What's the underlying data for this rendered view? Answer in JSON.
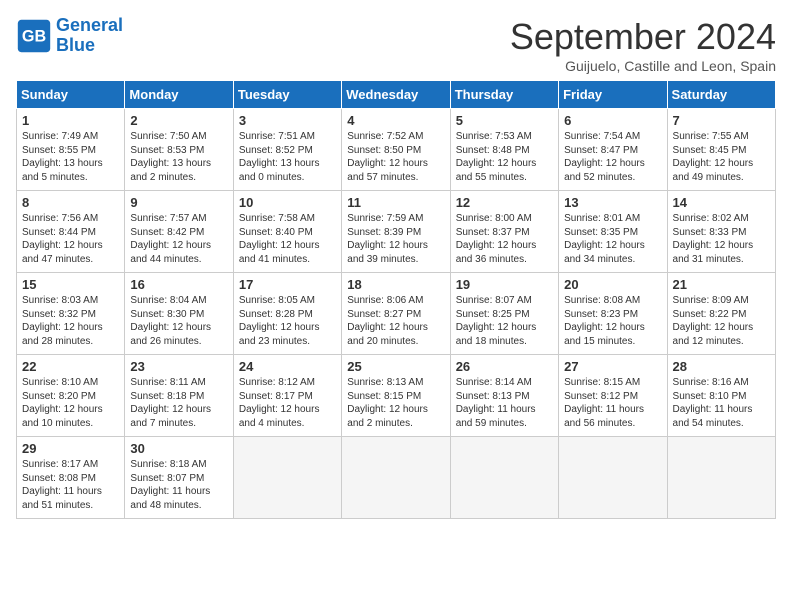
{
  "logo": {
    "line1": "General",
    "line2": "Blue"
  },
  "title": "September 2024",
  "subtitle": "Guijuelo, Castille and Leon, Spain",
  "headers": [
    "Sunday",
    "Monday",
    "Tuesday",
    "Wednesday",
    "Thursday",
    "Friday",
    "Saturday"
  ],
  "weeks": [
    [
      {
        "day": "1",
        "info": "Sunrise: 7:49 AM\nSunset: 8:55 PM\nDaylight: 13 hours\nand 5 minutes."
      },
      {
        "day": "2",
        "info": "Sunrise: 7:50 AM\nSunset: 8:53 PM\nDaylight: 13 hours\nand 2 minutes."
      },
      {
        "day": "3",
        "info": "Sunrise: 7:51 AM\nSunset: 8:52 PM\nDaylight: 13 hours\nand 0 minutes."
      },
      {
        "day": "4",
        "info": "Sunrise: 7:52 AM\nSunset: 8:50 PM\nDaylight: 12 hours\nand 57 minutes."
      },
      {
        "day": "5",
        "info": "Sunrise: 7:53 AM\nSunset: 8:48 PM\nDaylight: 12 hours\nand 55 minutes."
      },
      {
        "day": "6",
        "info": "Sunrise: 7:54 AM\nSunset: 8:47 PM\nDaylight: 12 hours\nand 52 minutes."
      },
      {
        "day": "7",
        "info": "Sunrise: 7:55 AM\nSunset: 8:45 PM\nDaylight: 12 hours\nand 49 minutes."
      }
    ],
    [
      {
        "day": "8",
        "info": "Sunrise: 7:56 AM\nSunset: 8:44 PM\nDaylight: 12 hours\nand 47 minutes."
      },
      {
        "day": "9",
        "info": "Sunrise: 7:57 AM\nSunset: 8:42 PM\nDaylight: 12 hours\nand 44 minutes."
      },
      {
        "day": "10",
        "info": "Sunrise: 7:58 AM\nSunset: 8:40 PM\nDaylight: 12 hours\nand 41 minutes."
      },
      {
        "day": "11",
        "info": "Sunrise: 7:59 AM\nSunset: 8:39 PM\nDaylight: 12 hours\nand 39 minutes."
      },
      {
        "day": "12",
        "info": "Sunrise: 8:00 AM\nSunset: 8:37 PM\nDaylight: 12 hours\nand 36 minutes."
      },
      {
        "day": "13",
        "info": "Sunrise: 8:01 AM\nSunset: 8:35 PM\nDaylight: 12 hours\nand 34 minutes."
      },
      {
        "day": "14",
        "info": "Sunrise: 8:02 AM\nSunset: 8:33 PM\nDaylight: 12 hours\nand 31 minutes."
      }
    ],
    [
      {
        "day": "15",
        "info": "Sunrise: 8:03 AM\nSunset: 8:32 PM\nDaylight: 12 hours\nand 28 minutes."
      },
      {
        "day": "16",
        "info": "Sunrise: 8:04 AM\nSunset: 8:30 PM\nDaylight: 12 hours\nand 26 minutes."
      },
      {
        "day": "17",
        "info": "Sunrise: 8:05 AM\nSunset: 8:28 PM\nDaylight: 12 hours\nand 23 minutes."
      },
      {
        "day": "18",
        "info": "Sunrise: 8:06 AM\nSunset: 8:27 PM\nDaylight: 12 hours\nand 20 minutes."
      },
      {
        "day": "19",
        "info": "Sunrise: 8:07 AM\nSunset: 8:25 PM\nDaylight: 12 hours\nand 18 minutes."
      },
      {
        "day": "20",
        "info": "Sunrise: 8:08 AM\nSunset: 8:23 PM\nDaylight: 12 hours\nand 15 minutes."
      },
      {
        "day": "21",
        "info": "Sunrise: 8:09 AM\nSunset: 8:22 PM\nDaylight: 12 hours\nand 12 minutes."
      }
    ],
    [
      {
        "day": "22",
        "info": "Sunrise: 8:10 AM\nSunset: 8:20 PM\nDaylight: 12 hours\nand 10 minutes."
      },
      {
        "day": "23",
        "info": "Sunrise: 8:11 AM\nSunset: 8:18 PM\nDaylight: 12 hours\nand 7 minutes."
      },
      {
        "day": "24",
        "info": "Sunrise: 8:12 AM\nSunset: 8:17 PM\nDaylight: 12 hours\nand 4 minutes."
      },
      {
        "day": "25",
        "info": "Sunrise: 8:13 AM\nSunset: 8:15 PM\nDaylight: 12 hours\nand 2 minutes."
      },
      {
        "day": "26",
        "info": "Sunrise: 8:14 AM\nSunset: 8:13 PM\nDaylight: 11 hours\nand 59 minutes."
      },
      {
        "day": "27",
        "info": "Sunrise: 8:15 AM\nSunset: 8:12 PM\nDaylight: 11 hours\nand 56 minutes."
      },
      {
        "day": "28",
        "info": "Sunrise: 8:16 AM\nSunset: 8:10 PM\nDaylight: 11 hours\nand 54 minutes."
      }
    ],
    [
      {
        "day": "29",
        "info": "Sunrise: 8:17 AM\nSunset: 8:08 PM\nDaylight: 11 hours\nand 51 minutes."
      },
      {
        "day": "30",
        "info": "Sunrise: 8:18 AM\nSunset: 8:07 PM\nDaylight: 11 hours\nand 48 minutes."
      },
      {
        "day": "",
        "info": ""
      },
      {
        "day": "",
        "info": ""
      },
      {
        "day": "",
        "info": ""
      },
      {
        "day": "",
        "info": ""
      },
      {
        "day": "",
        "info": ""
      }
    ]
  ]
}
